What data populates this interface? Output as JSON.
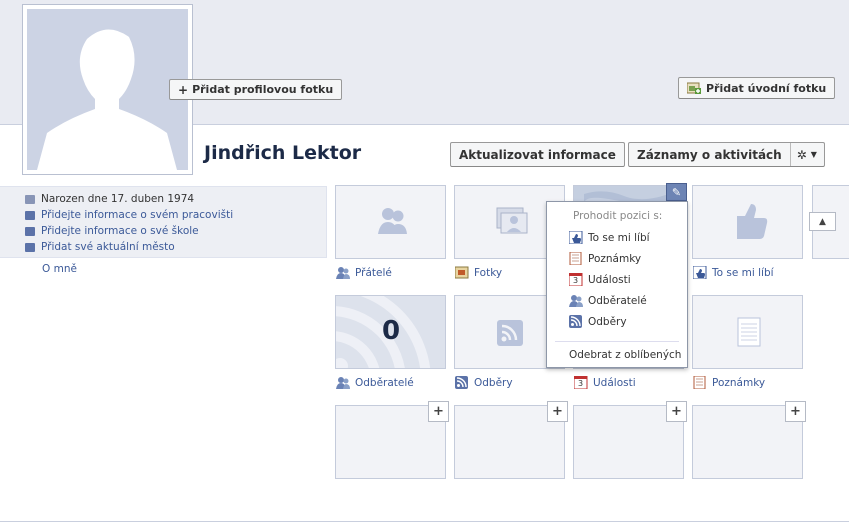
{
  "profile": {
    "name": "Jindřich Lektor",
    "add_profile_photo": "Přidat profilovou fotku",
    "add_cover_photo": "Přidat úvodní fotku",
    "update_info": "Aktualizovat informace",
    "activity_log": "Záznamy o aktivitách"
  },
  "info": {
    "born": "Narozen dne 17. duben 1974",
    "work": "Přidejte informace o svém pracovišti",
    "school": "Přidejte informace o své škole",
    "city": "Přidat své aktuální město",
    "about": "O mně"
  },
  "tiles": {
    "friends": "Přátelé",
    "photos": "Fotky",
    "likes": "To se mi líbí",
    "subscribers": "Odběratelé",
    "subscribers_count": "0",
    "subscriptions": "Odběry",
    "events": "Události",
    "notes": "Poznámky",
    "events_icon_num": "3"
  },
  "dropdown": {
    "header": "Prohodit pozici s:",
    "items": [
      "To se mi líbí",
      "Poznámky",
      "Události",
      "Odběratelé",
      "Odběry"
    ],
    "remove": "Odebrat z oblíbených",
    "event_icon_num": "3"
  },
  "colors": {
    "link": "#3b5998",
    "cover_bg": "#e9ebf2",
    "tile_bg": "#f2f3f7"
  }
}
